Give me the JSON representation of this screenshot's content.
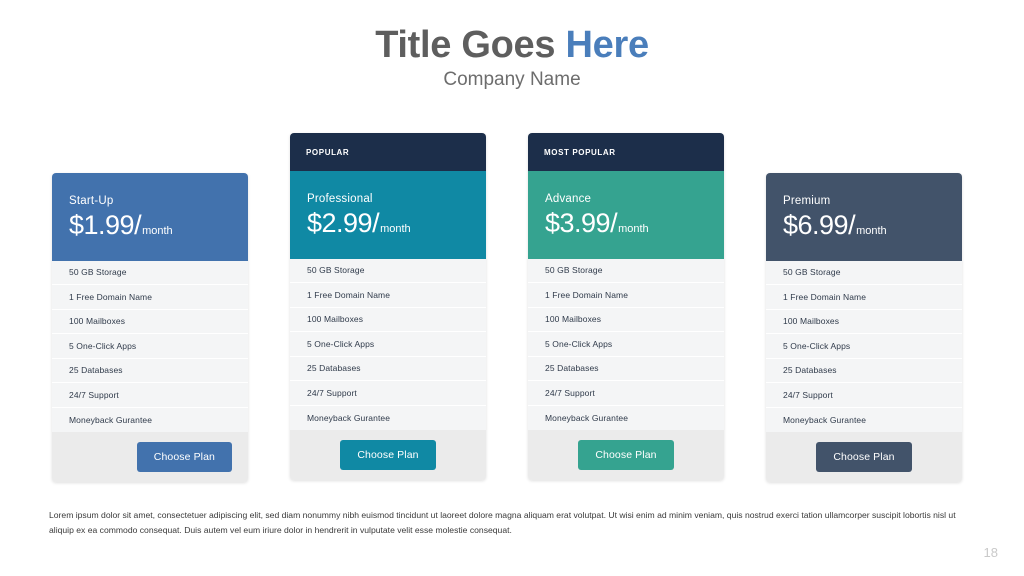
{
  "header": {
    "title_plain": "Title Goes ",
    "title_accent": "Here",
    "subtitle": "Company Name"
  },
  "colors": {
    "title_gray": "#5e5e5e",
    "title_accent": "#4a7ebb",
    "ribbon_navy": "#1c2e4a",
    "card1": "#4272ad",
    "card2": "#1089a4",
    "card3": "#35a390",
    "card4": "#42536a",
    "feature_bg": "#f4f5f6",
    "cta_zone_bg": "#ebebeb"
  },
  "features": [
    "50 GB Storage",
    "1 Free Domain Name",
    "100 Mailboxes",
    "5 One-Click Apps",
    "25 Databases",
    "24/7 Support",
    "Moneyback Gurantee"
  ],
  "cards": [
    {
      "ribbon": "",
      "plan": "Start-Up",
      "price": "$1.99/",
      "period": "month",
      "cta": "Choose Plan",
      "accent": "#4272ad",
      "button_align": "right"
    },
    {
      "ribbon": "POPULAR",
      "plan": "Professional",
      "price": "$2.99/",
      "period": "month",
      "cta": "Choose Plan",
      "accent": "#1089a4",
      "button_align": "center"
    },
    {
      "ribbon": "MOST POPULAR",
      "plan": "Advance",
      "price": "$3.99/",
      "period": "month",
      "cta": "Choose Plan",
      "accent": "#35a390",
      "button_align": "center"
    },
    {
      "ribbon": "",
      "plan": "Premium",
      "price": "$6.99/",
      "period": "month",
      "cta": "Choose Plan",
      "accent": "#42536a",
      "button_align": "center"
    }
  ],
  "footer": {
    "body": "Lorem ipsum dolor sit amet, consectetuer adipiscing elit, sed diam nonummy nibh euismod tincidunt ut laoreet dolore magna aliquam erat volutpat. Ut wisi enim ad minim veniam, quis nostrud exerci tation ullamcorper suscipit lobortis nisl ut aliquip ex ea commodo consequat. Duis autem vel eum iriure dolor in hendrerit in vulputate velit esse molestie consequat.",
    "page_number": "18"
  }
}
